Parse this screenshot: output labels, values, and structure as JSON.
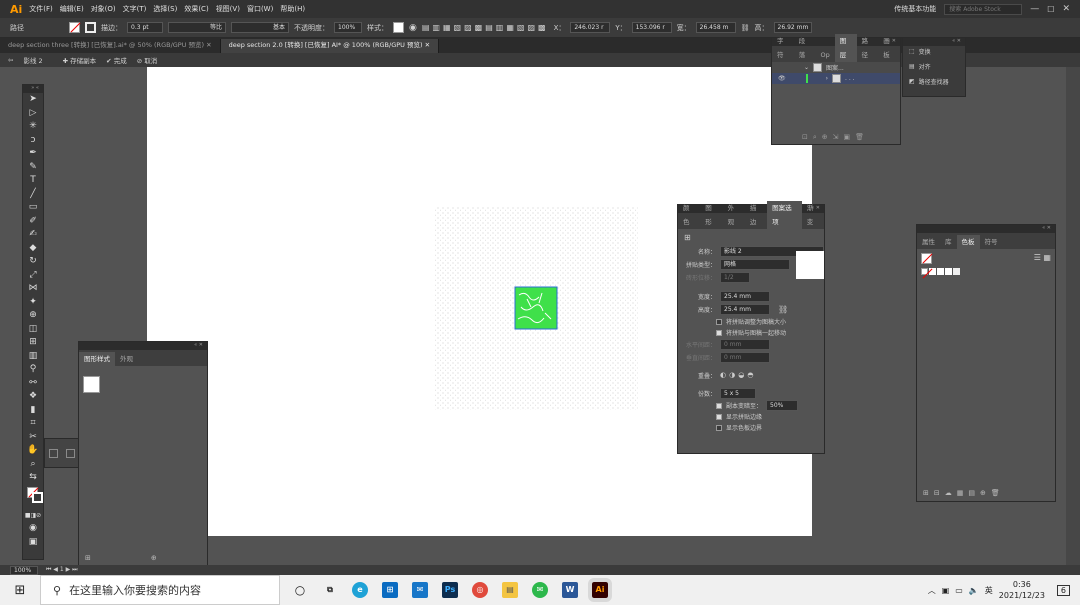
{
  "menubar": {
    "logo": "Ai",
    "items": [
      "文件(F)",
      "编辑(E)",
      "对象(O)",
      "文字(T)",
      "选择(S)",
      "效果(C)",
      "视图(V)",
      "窗口(W)",
      "帮助(H)"
    ],
    "workspace": "传统基本功能",
    "search_placeholder": "搜索 Adobe Stock"
  },
  "controlbar": {
    "label": "路径",
    "stroke_label": "描边：",
    "stroke_value": "0.3 pt",
    "profile": "等比",
    "brush": "基本",
    "opacity_label": "不透明度：",
    "opacity": "100%",
    "style_label": "样式：",
    "x_label": "X：",
    "x_value": "246.023 r",
    "y_label": "Y：",
    "y_value": "153.096 r",
    "w_label": "宽：",
    "w_value": "26.458 m",
    "h_label": "高：",
    "h_value": "26.92 mm"
  },
  "tabs": [
    "deep section three [转换] [已恢复].ai* @ 50% (RGB/GPU 预览)",
    "deep section 2.0 [转换] [已恢复] AI* @ 100% (RGB/GPU 预览)"
  ],
  "isolation": {
    "layer": "影线 2",
    "save": "存储副本",
    "done": "完成",
    "cancel": "取消"
  },
  "layers_panel": {
    "tabs": [
      "字符",
      "段落",
      "Op",
      "图层",
      "路径",
      "画板"
    ],
    "rows": [
      "图案...",
      ". . ."
    ]
  },
  "transform_menu": {
    "items": [
      "变换",
      "对齐",
      "路径查找器"
    ]
  },
  "pattern_panel": {
    "tabs": [
      "颜色",
      "图形",
      "外观",
      "描边",
      "图案选项",
      "渐变"
    ],
    "name_label": "名称：",
    "name_value": "影线 2",
    "tile_type_label": "拼贴类型：",
    "tile_type_value": "网格",
    "brick_label": "砖形位移：",
    "brick_value": "1/2",
    "width_label": "宽度：",
    "width_value": "25.4 mm",
    "height_label": "高度：",
    "height_value": "25.4 mm",
    "opt1": "将拼贴调整为图稿大小",
    "opt2": "将拼贴与图稿一起移动",
    "h_spacing_label": "水平间距：",
    "h_spacing_value": "0 mm",
    "v_spacing_label": "垂直间距：",
    "v_spacing_value": "0 mm",
    "overlap_label": "重叠：",
    "copies_label": "份数：",
    "copies_value": "5 x 5",
    "dim_label": "副本变暗至：",
    "dim_value": "50%",
    "show_tile_edge": "显示拼贴边缘",
    "show_swatch_bounds": "显示色板边界"
  },
  "swatches_panel": {
    "tabs": [
      "属性",
      "库",
      "色板",
      "符号"
    ]
  },
  "graphic_styles_panel": {
    "tabs": [
      "图形样式",
      "外观"
    ]
  },
  "statusbar": {
    "zoom": "100%",
    "page": "1"
  },
  "taskbar": {
    "search_placeholder": "在这里输入你要搜索的内容",
    "time": "0:36",
    "date": "2021/12/23",
    "lang": "英",
    "notify": "6"
  },
  "colors": {
    "accent": "#3fe04a",
    "bg": "#535353"
  }
}
